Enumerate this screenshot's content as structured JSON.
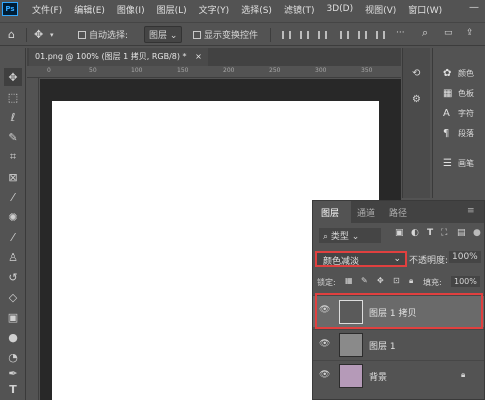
{
  "app": {
    "logo": "Ps"
  },
  "menubar": {
    "items": [
      "文件(F)",
      "编辑(E)",
      "图像(I)",
      "图层(L)",
      "文字(Y)",
      "选择(S)",
      "滤镜(T)",
      "3D(D)",
      "视图(V)",
      "窗口(W)"
    ],
    "minimize": "—"
  },
  "options": {
    "auto_select_label": "自动选择:",
    "auto_select_value": "图层",
    "show_transform_label": "显示变换控件",
    "more": "···",
    "search_icon": "search-icon"
  },
  "document": {
    "tab_title": "01.png @ 100% (图层 1 拷贝, RGB/8) *",
    "close": "×",
    "ruler_ticks": [
      "0",
      "50",
      "100",
      "150",
      "200",
      "250",
      "300",
      "350"
    ]
  },
  "dock": {
    "items": [
      {
        "icon": "palette-icon",
        "label": "颜色"
      },
      {
        "icon": "grid-icon",
        "label": "色板"
      },
      {
        "icon": "type-icon",
        "label": "字符"
      },
      {
        "icon": "paragraph-icon",
        "label": "段落"
      },
      {
        "icon": "brush-icon",
        "label": "画笔"
      }
    ]
  },
  "layers_panel": {
    "tabs": [
      "图层",
      "通道",
      "路径"
    ],
    "filter_label": "类型",
    "blend_mode": "颜色减淡",
    "opacity_label": "不透明度:",
    "opacity_value": "100%",
    "lock_label": "锁定:",
    "fill_label": "填充:",
    "fill_value": "100%",
    "layers": [
      {
        "name": "图层 1 拷贝",
        "selected": true
      },
      {
        "name": "图层 1",
        "selected": false
      },
      {
        "name": "背景",
        "selected": false,
        "locked": true
      }
    ]
  },
  "colors": {
    "accent_highlight": "#e0403f",
    "canvas": "#ffffff",
    "panel": "#535353"
  }
}
